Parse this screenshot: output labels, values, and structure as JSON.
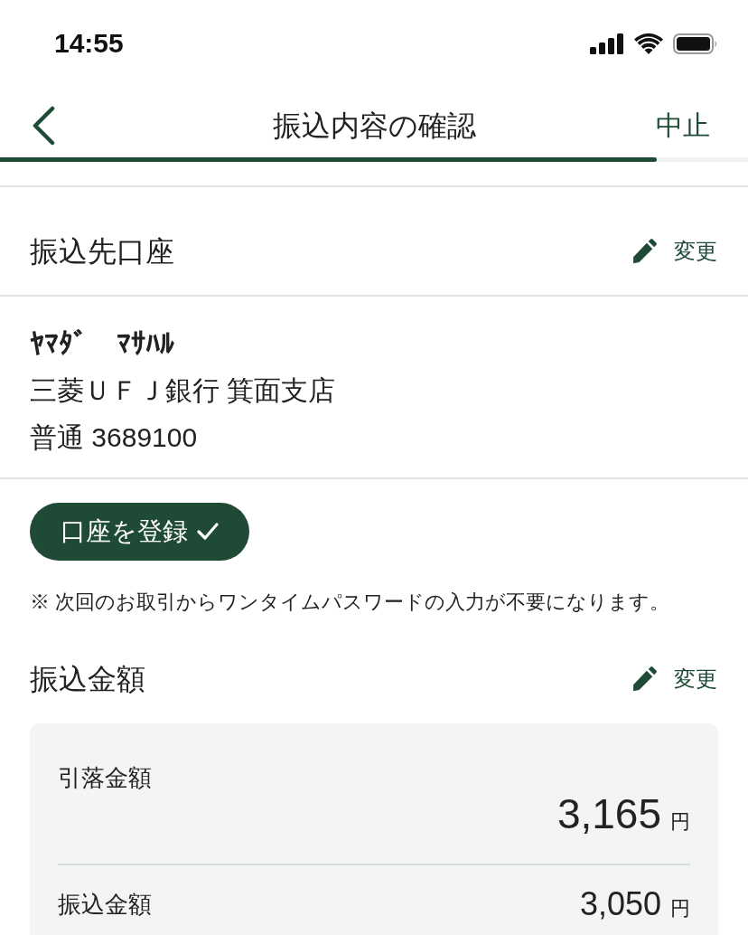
{
  "status_bar": {
    "time": "14:55"
  },
  "nav": {
    "title": "振込内容の確認",
    "cancel": "中止",
    "progress": {
      "level": 0.878
    }
  },
  "sections": [
    {
      "kind": "account",
      "title": "振込先口座",
      "edit_label": "変更",
      "account": {
        "name": "ﾔﾏﾀﾞ　ﾏｻﾊﾙ",
        "bank": "三菱ＵＦＪ銀行 箕面支店",
        "number": "普通 3689100"
      },
      "register_button": {
        "label": "口座を登録",
        "checked": true
      },
      "note": "※ 次回のお取引からワンタイムパスワードの入力が不要になります。"
    },
    {
      "kind": "amount",
      "title": "振込金額",
      "edit_label": "変更",
      "rows": [
        {
          "kind": "total",
          "label": "引落金額",
          "amount": "3,165",
          "unit": "円"
        },
        {
          "kind": "line",
          "label": "振込金額",
          "amount": "3,050",
          "unit": "円"
        }
      ]
    }
  ]
}
